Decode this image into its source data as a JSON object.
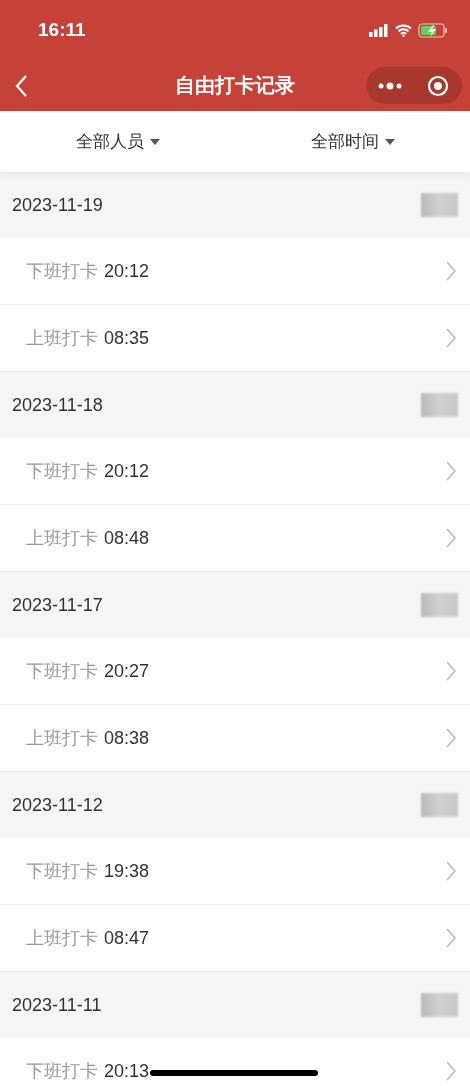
{
  "status_bar": {
    "time": "16:11"
  },
  "nav": {
    "title": "自由打卡记录"
  },
  "filters": [
    {
      "label": "全部人员"
    },
    {
      "label": "全部时间"
    }
  ],
  "days": [
    {
      "date": "2023-11-19",
      "records": [
        {
          "label": "下班打卡",
          "time": "20:12"
        },
        {
          "label": "上班打卡",
          "time": "08:35"
        }
      ]
    },
    {
      "date": "2023-11-18",
      "records": [
        {
          "label": "下班打卡",
          "time": "20:12"
        },
        {
          "label": "上班打卡",
          "time": "08:48"
        }
      ]
    },
    {
      "date": "2023-11-17",
      "records": [
        {
          "label": "下班打卡",
          "time": "20:27"
        },
        {
          "label": "上班打卡",
          "time": "08:38"
        }
      ]
    },
    {
      "date": "2023-11-12",
      "records": [
        {
          "label": "下班打卡",
          "time": "19:38"
        },
        {
          "label": "上班打卡",
          "time": "08:47"
        }
      ]
    },
    {
      "date": "2023-11-11",
      "records": [
        {
          "label": "下班打卡",
          "time": "20:13"
        }
      ]
    }
  ]
}
